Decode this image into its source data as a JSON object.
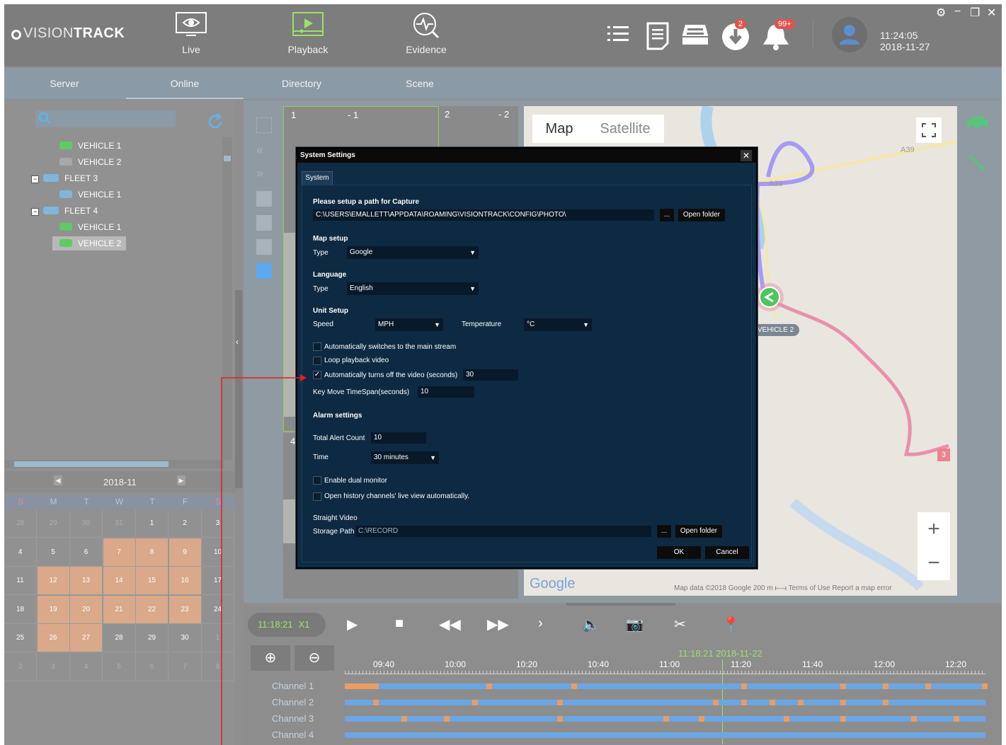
{
  "header": {
    "logo_a": "VISION",
    "logo_b": "TRACK",
    "nav": [
      {
        "label": "Live",
        "icon": "eye-icon"
      },
      {
        "label": "Playback",
        "icon": "play-screen-icon"
      },
      {
        "label": "Evidence",
        "icon": "pulse-search-icon"
      }
    ],
    "download_badge": "2",
    "alarm_badge": "99+",
    "time": "11:24:05",
    "date": "2018-11-27"
  },
  "tabs": [
    "Server",
    "Online",
    "Directory",
    "Scene"
  ],
  "tree": [
    {
      "label": "VEHICLE 1",
      "indent": 2,
      "state": "online"
    },
    {
      "label": "VEHICLE 2",
      "indent": 2,
      "state": "offline"
    },
    {
      "label": "FLEET 3",
      "indent": 1,
      "state": "fleet"
    },
    {
      "label": "VEHICLE 1",
      "indent": 2,
      "state": "vehicle"
    },
    {
      "label": "FLEET 4",
      "indent": 1,
      "state": "fleet"
    },
    {
      "label": "VEHICLE 1",
      "indent": 2,
      "state": "online"
    },
    {
      "label": "VEHICLE 2",
      "indent": 2,
      "state": "selected"
    }
  ],
  "calendar": {
    "month": "2018-11",
    "weekdays": [
      "S",
      "M",
      "T",
      "W",
      "T",
      "F",
      "S"
    ],
    "weeks": [
      [
        "28",
        "29",
        "30",
        "31",
        "1",
        "2",
        "3"
      ],
      [
        "4",
        "5",
        "6",
        "7",
        "8",
        "9",
        "10"
      ],
      [
        "11",
        "12",
        "13",
        "14",
        "15",
        "16",
        "17"
      ],
      [
        "18",
        "19",
        "20",
        "21",
        "22",
        "23",
        "24"
      ],
      [
        "25",
        "26",
        "27",
        "28",
        "29",
        "30",
        "1"
      ],
      [
        "2",
        "3",
        "4",
        "5",
        "6",
        "7",
        "8"
      ]
    ]
  },
  "video": {
    "tile1_num": "1",
    "tile1_ch": "- 1",
    "tile2_num": "2",
    "tile2_ch": "- 2",
    "tile4_num": "4"
  },
  "map": {
    "tab_map": "Map",
    "tab_satellite": "Satellite",
    "road_a39": "A39",
    "road_a39_b": "A39",
    "vehicle_label": "VEHICLE 2",
    "marker_3": "3",
    "google": "Google",
    "footer": "Map data ©2018 Google   200 m ⟝⟞   Terms of Use   Report a map error",
    "zoom_in": "+",
    "zoom_out": "−"
  },
  "dialog": {
    "title": "System Settings",
    "tab": "System",
    "capture_head": "Please setup a path for Capture",
    "capture_path": "C:\\USERS\\EMALLETT\\APPDATA\\ROAMING\\VISIONTRACK\\CONFIG\\PHOTO\\",
    "browse": "...",
    "open_folder": "Open folder",
    "map_head": "Map setup",
    "map_type_label": "Type",
    "map_type_value": "Google",
    "lang_head": "Language",
    "lang_type_label": "Type",
    "lang_value": "English",
    "unit_head": "Unit Setup",
    "speed_label": "Speed",
    "speed_value": "MPH",
    "temp_label": "Temperature",
    "temp_value": "°C",
    "cb_main_stream": "Automatically switches to the main stream",
    "cb_loop": "Loop playback video",
    "cb_turnoff": "Automatically turns off the video (seconds)",
    "turnoff_value": "30",
    "keymove_label": "Key Move TimeSpan(seconds)",
    "keymove_value": "10",
    "alarm_head": "Alarm settings",
    "alert_count_label": "Total Alert Count",
    "alert_count_value": "10",
    "time_label": "Time",
    "time_value": "30 minutes",
    "cb_dual": "Enable dual monitor",
    "cb_history": "Open history channels' live view automatically.",
    "straight_head": "Straight Video",
    "storage_label": "Storage Path",
    "storage_value": "C:\\RECORD",
    "browse2": "...",
    "open_folder2": "Open folder",
    "ok": "OK",
    "cancel": "Cancel"
  },
  "player": {
    "time": "11:18:21",
    "speed": "X1",
    "current": "11:18:21 2018-11-22",
    "ticks": [
      "09:40",
      "10:00",
      "10:20",
      "10:40",
      "11:00",
      "11:20",
      "11:40",
      "12:00",
      "12:20"
    ],
    "channels": [
      "Channel 1",
      "Channel 2",
      "Channel 3",
      "Channel 4"
    ]
  },
  "colors": {
    "accent_green": "#59c47a",
    "route_pink": "#e98fb0",
    "route_purple": "#a69af2",
    "dialog_bg": "#0f2c45",
    "annotation_red": "#e02020"
  }
}
